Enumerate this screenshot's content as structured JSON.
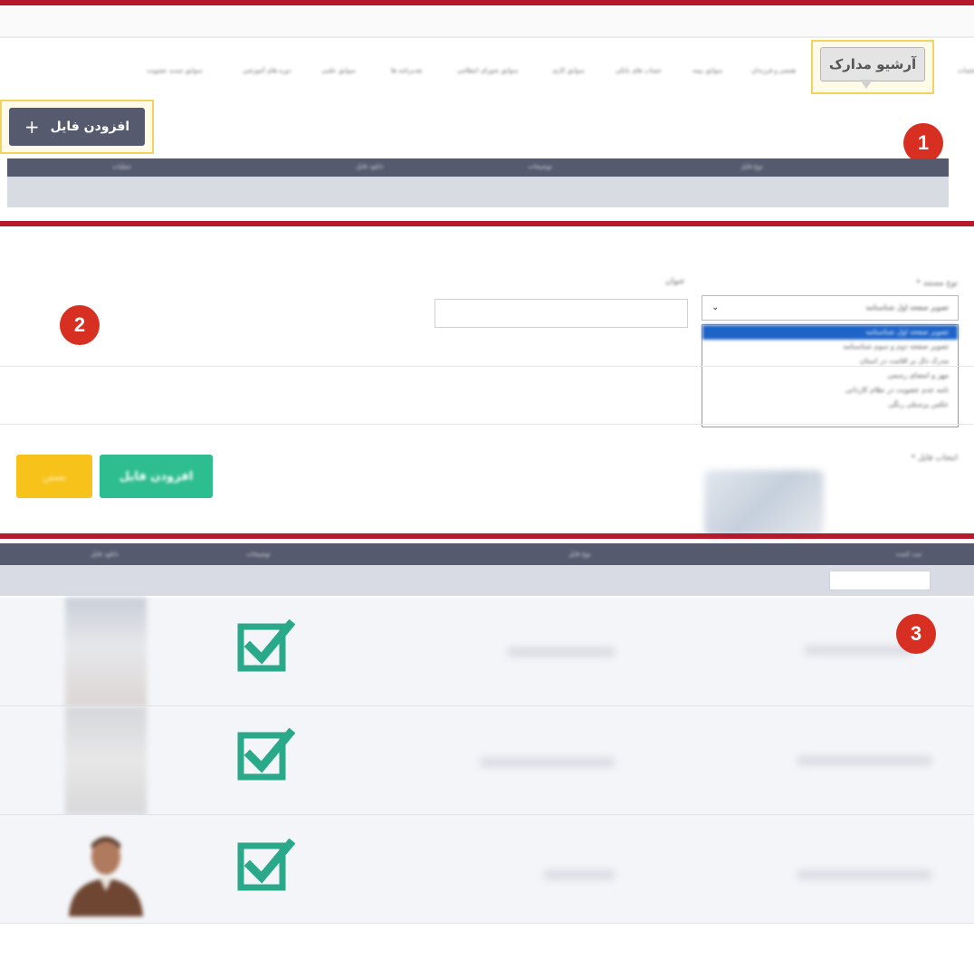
{
  "tabs": {
    "active": "آرشیو مدارک",
    "items": [
      "مشخصات",
      "همسر و فرزندان",
      "سوابق بیمه",
      "حساب های بانکی",
      "سوابق کاری",
      "سوابق شورای انتظامی",
      "تقدیرنامه ها",
      "سوابق علمی",
      "دوره های آموزشی",
      "سوابق تمدید عضویت"
    ]
  },
  "panel1": {
    "add_button": "افزودن فایل",
    "add_icon": "plus-icon",
    "columns": [
      "نوع فایل",
      "توضیحات",
      "دانلود فایل",
      "عملیات"
    ]
  },
  "panel2": {
    "doc_type_label": "نوع مستند *",
    "title_label": "عنوان",
    "select_value": "تصویر صفحه اول شناسنامه",
    "options": [
      "تصویر صفحه اول شناسنامه",
      "تصویر صفحه دوم و سوم شناسنامه",
      "مدرک دال بر اقامت در استان",
      "مهر و امضای رسمی",
      "نامه عدم عضویت در نظام کاردانی",
      "عکس پرسنلی رنگی"
    ],
    "file_select_label": "انتخاب فایل *",
    "add_button": "افزودن فایل",
    "close_button": "بستن"
  },
  "panel3": {
    "columns": [
      "ثبت کننده",
      "نوع فایل",
      "توضیحات",
      "دانلود فایل"
    ]
  },
  "badges": [
    "1",
    "2",
    "3"
  ],
  "colors": {
    "divider": "#b5192b",
    "header": "#565a6e",
    "badge": "#d72f22",
    "accent_green": "#2ebd8e",
    "accent_yellow": "#f7c219",
    "highlight": "#f2d35b",
    "check": "#2aa88a"
  }
}
